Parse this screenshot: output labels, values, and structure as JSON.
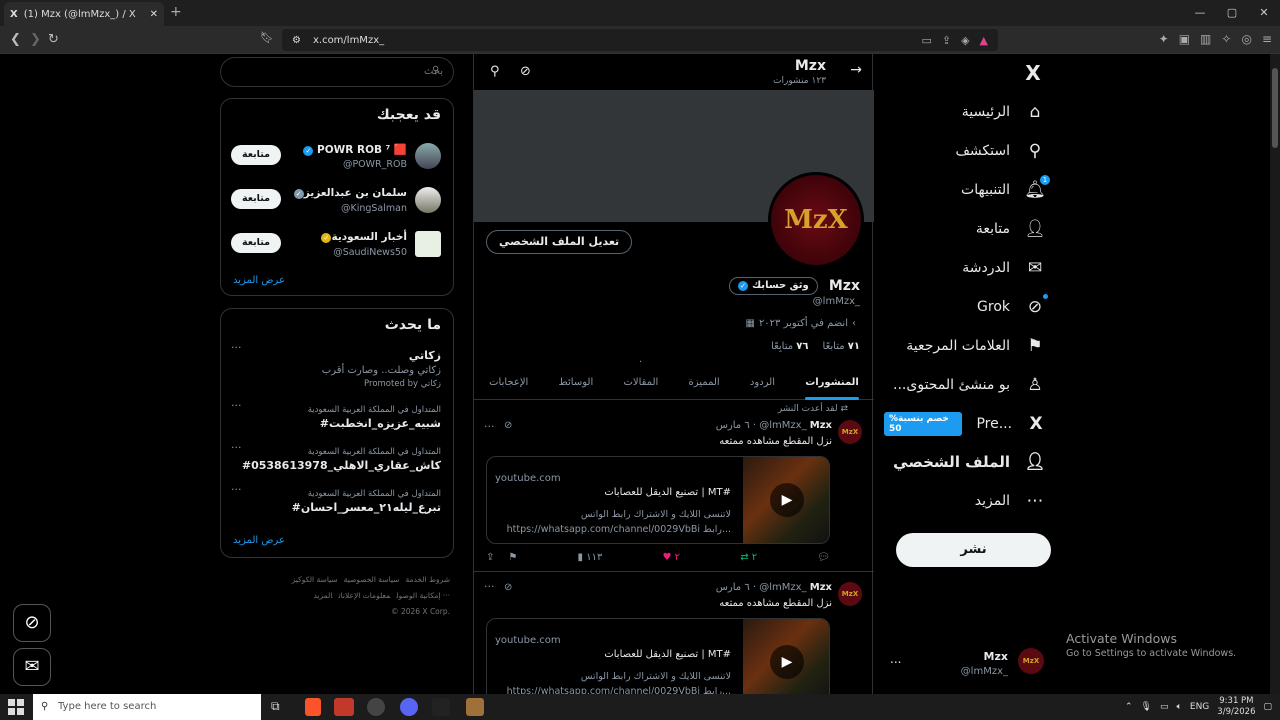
{
  "browser": {
    "tab_title": "(1) Mzx (@lmMzx_) / X",
    "tab_x_glyph": "X",
    "url": "x.com/lmMzx_"
  },
  "nav": {
    "home": "الرئيسية",
    "explore": "استكشف",
    "notifications": "التنبيهات",
    "notifications_count": "1",
    "follow": "متابعة",
    "chat": "الدردشة",
    "grok": "Grok",
    "bookmarks": "العلامات المرجعية",
    "creators": "...بو منشئ المحتوى",
    "premium": "Pre...",
    "premium_badge": "%خصم بنسبة 50",
    "profile": "الملف الشخصي",
    "more": "المزيد",
    "post_button": "نشر"
  },
  "account": {
    "name": "Mzx",
    "handle": "@lmMzx_",
    "avatar_text": "MzX",
    "more": "..."
  },
  "header": {
    "title": "Mzx",
    "subtitle": "١٢٣ منشورات"
  },
  "profile": {
    "avatar_text": "MzX",
    "edit_button": "تعديل الملف الشخصي",
    "verify_button": "وثق حسابك",
    "name": "Mzx",
    "handle": "@lmMzx_",
    "joined": "انضم في أكتوبر ٢٠٢٣",
    "following_count": "٧١",
    "following_label": "متابعًا",
    "followers_count": "٧٦",
    "followers_label": "متابِعًا",
    "dot": "."
  },
  "tabs": [
    "المنشورات",
    "الردود",
    "المميزة",
    "المقالات",
    "الوسائط",
    "الإعجابات"
  ],
  "tweets": [
    {
      "repost": "لقد أعدت النشر",
      "name": "Mzx",
      "handle": "@lmMzx_",
      "date": "٦ مارس",
      "sep": "·",
      "text": "نزل المقطع مشاهده ممتعه",
      "card_domain": "youtube.com",
      "card_title": "تصنيع الديقل للعصابات | MT#",
      "card_desc": "لاتنسى اللايك و الاشتراك رابط الواتس https://whatsapp.com/channel/0029VbBi رابط...",
      "replies": "",
      "reposts": "٢",
      "likes": "٢",
      "views": "١١٣"
    },
    {
      "repost": "",
      "name": "Mzx",
      "handle": "@lmMzx_",
      "date": "٦ مارس",
      "sep": "·",
      "text": "نزل المقطع مشاهده ممتعه",
      "card_domain": "youtube.com",
      "card_title": "تصنيع الديقل للعصابات | MT#",
      "card_desc": "لاتنسى اللايك و الاشتراك رابط الواتس https://whatsapp.com/channel/0029VbBi رابط..."
    }
  ],
  "sidebar": {
    "search_placeholder": "بحث",
    "wtf_title": "قد يعجبك",
    "wtf": [
      {
        "name": "POWR ROB ⁷ 🟥",
        "handle": "@POWR_ROB",
        "button": "متابعة"
      },
      {
        "name": "سلمان بن عبدالعزيز",
        "handle": "@KingSalman",
        "button": "متابعة"
      },
      {
        "name": "أخبار السعودية",
        "handle": "@SaudiNews50",
        "button": "متابعة"
      }
    ],
    "wtf_more": "عرض المزيد",
    "trends_title": "ما يحدث",
    "promoted": {
      "title": "زكاتي",
      "text": "زكاتي وصلت.. وصارت أقرب",
      "label": "Promoted by زكاتي"
    },
    "trends": [
      {
        "context": "المتداول في المملكة العربية السعودية",
        "title": "#شبيه_عزيزه_انخطبت"
      },
      {
        "context": "المتداول في المملكة العربية السعودية",
        "title": "#كاش_عقاري_الاهلي_0538613978"
      },
      {
        "context": "المتداول في المملكة العربية السعودية",
        "title": "#تبرع_ليله٢١_معسر_احسان"
      }
    ],
    "trends_more": "عرض المزيد",
    "footer": {
      "l1a": "شروط الخدمة",
      "l1b": "سياسة الخصوصية",
      "l1c": "سياسة الكوكيز",
      "l2a": "إمكانية الوصول",
      "l2b": "معلومات الإعلانات",
      "l2c": "المزيد ···",
      "copy": "© 2026 X Corp."
    }
  },
  "watermark": {
    "line1": "Activate Windows",
    "line2": "Go to Settings to activate Windows."
  },
  "taskbar": {
    "search_placeholder": "Type here to search",
    "lang": "ENG",
    "time": "9:31 PM",
    "date": "3/9/2026"
  },
  "colors": {
    "accent": "#1d9bf0",
    "like": "#f91880",
    "repost": "#00ba7c",
    "brand_red": "#5a0a10",
    "brand_gold": "#d4a028"
  }
}
